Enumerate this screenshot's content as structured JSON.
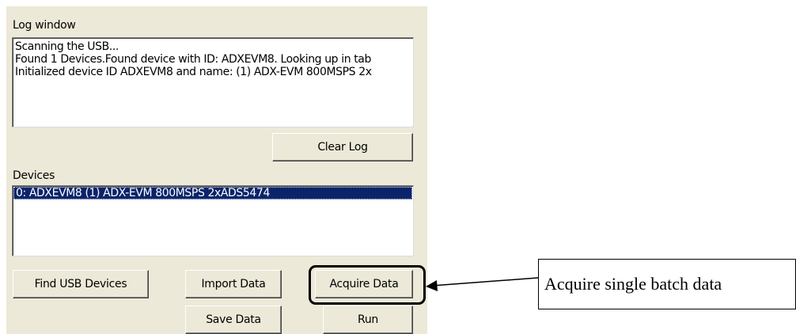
{
  "log_window": {
    "label": "Log window",
    "lines": [
      "Scanning the USB...",
      "Found 1 Devices.Found device with ID: ADXEVM8. Looking up in tab",
      "Initialized device ID ADXEVM8 and name: (1) ADX-EVM 800MSPS 2x"
    ],
    "clear_button": "Clear Log"
  },
  "devices": {
    "label": "Devices",
    "items": [
      "0: ADXEVM8 (1) ADX-EVM 800MSPS 2xADS5474"
    ]
  },
  "buttons": {
    "find_usb": "Find USB Devices",
    "import_data": "Import Data",
    "acquire_data": "Acquire Data",
    "save_data": "Save Data",
    "run": "Run"
  },
  "annotation": {
    "callout_text": "Acquire single batch data"
  }
}
